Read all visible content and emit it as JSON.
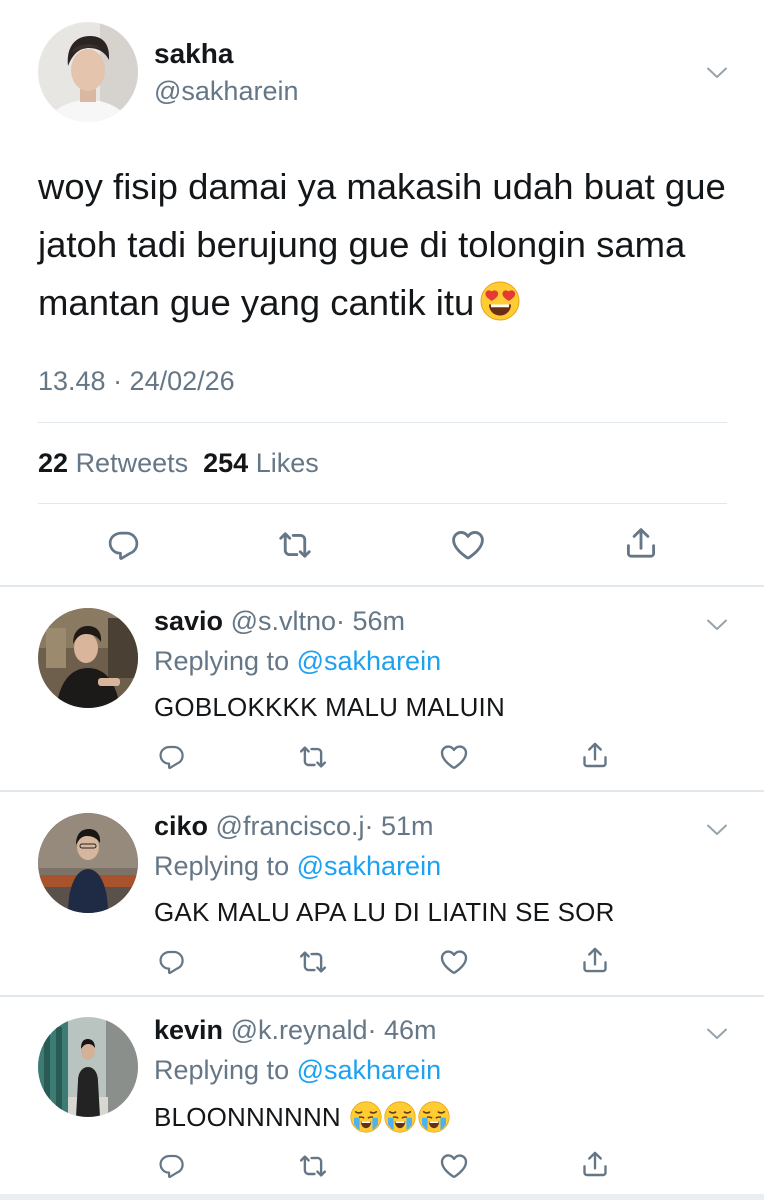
{
  "main_tweet": {
    "name": "sakha",
    "handle": "@sakharein",
    "text": "woy fisip damai ya makasih udah buat gue jatoh tadi berujung gue di tolongin sama mantan gue yang cantik itu",
    "text_emoji": "smiling-face-with-heart-eyes",
    "timestamp": "13.48 · 24/02/26",
    "retweets_count": "22",
    "retweets_label": "Retweets",
    "likes_count": "254",
    "likes_label": "Likes"
  },
  "replies": [
    {
      "name": "savio",
      "handle": "@s.vltno",
      "time": "· 56m",
      "replying_label": "Replying to",
      "replying_to": "@sakharein",
      "text": "GOBLOKKKK MALU MALUIN",
      "emojis": []
    },
    {
      "name": "ciko",
      "handle": "@francisco.j",
      "time": "· 51m",
      "replying_label": "Replying to",
      "replying_to": "@sakharein",
      "text": "GAK MALU APA LU DI LIATIN SE SOR",
      "emojis": []
    },
    {
      "name": "kevin",
      "handle": "@k.reynald",
      "time": "· 46m",
      "replying_label": "Replying to",
      "replying_to": "@sakharein",
      "text": "BLOONNNNNN",
      "emojis": [
        "loudly-crying-face",
        "loudly-crying-face",
        "loudly-crying-face"
      ]
    }
  ],
  "icons": {
    "reply": "reply-icon",
    "retweet": "retweet-icon",
    "like": "heart-icon",
    "share": "share-icon",
    "more": "chevron-down-icon"
  },
  "colors": {
    "text": "#14171a",
    "secondary": "#657786",
    "link": "#1da1f2",
    "divider": "#e1e8ed"
  }
}
